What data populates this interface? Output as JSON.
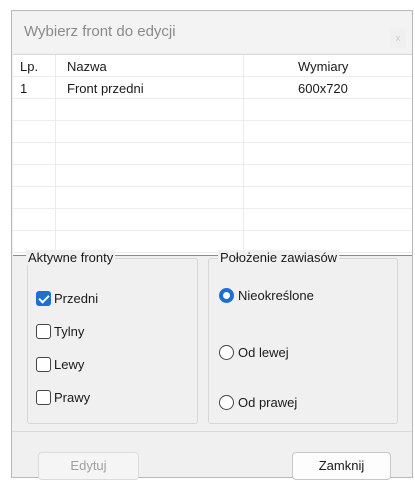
{
  "window": {
    "title": "Wybierz front do edycji",
    "close_glyph": "x"
  },
  "grid": {
    "columns": [
      "Lp.",
      "Nazwa",
      "Wymiary"
    ],
    "rows": [
      {
        "lp": "1",
        "nazwa": "Front przedni",
        "wymiary": "600x720"
      }
    ]
  },
  "aktywne_fronty": {
    "title": "Aktywne fronty",
    "options": [
      {
        "label": "Przedni",
        "checked": true
      },
      {
        "label": "Tylny",
        "checked": false
      },
      {
        "label": "Lewy",
        "checked": false
      },
      {
        "label": "Prawy",
        "checked": false
      }
    ]
  },
  "polozenie_zawiasow": {
    "title": "Położenie zawiasów",
    "options": [
      {
        "label": "Nieokreślone",
        "selected": true
      },
      {
        "label": "Od lewej",
        "selected": false
      },
      {
        "label": "Od prawej",
        "selected": false
      }
    ]
  },
  "buttons": {
    "edit_label": "Edytuj",
    "close_label": "Zamknij"
  },
  "colors": {
    "accent": "#1f6fd1"
  }
}
